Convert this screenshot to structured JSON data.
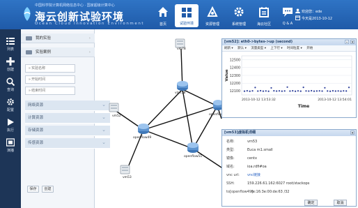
{
  "header": {
    "slogan": "中国科学院计算机网络信息中心 · 国家超级计算中心",
    "title": "海云创新试验环境",
    "subtitle": "Ocean Cloud Innovation Environment",
    "nav": [
      {
        "label": "首页",
        "icon": "home-icon"
      },
      {
        "label": "试验环境",
        "icon": "grid-icon",
        "active": true
      },
      {
        "label": "资源管理",
        "icon": "resource-icon"
      },
      {
        "label": "系统管理",
        "icon": "gear-icon"
      },
      {
        "label": "海云社区",
        "icon": "community-icon"
      },
      {
        "label": "Q & A",
        "icon": "chat-icon"
      }
    ],
    "user": {
      "welcome": "欢迎您：ede",
      "date": "今天是2013-10-12"
    }
  },
  "toolbar": [
    {
      "label": "列表",
      "icon": "list-icon"
    },
    {
      "label": "创建",
      "icon": "plus-icon"
    },
    {
      "label": "查询",
      "icon": "search-icon"
    },
    {
      "label": "配置",
      "icon": "gear-icon"
    },
    {
      "label": "执行",
      "icon": "play-icon"
    },
    {
      "label": "演播",
      "icon": "film-icon"
    }
  ],
  "side": {
    "sections": [
      "我的实验",
      "实验案例"
    ],
    "fields": [
      {
        "placeholder": "» 实验名称"
      },
      {
        "placeholder": "» 开始时间"
      },
      {
        "placeholder": "» 结束时间"
      }
    ],
    "accordions": [
      "网络资源",
      "计算资源",
      "存储资源",
      "传感资源"
    ],
    "buttons": [
      "保存",
      "创建"
    ]
  },
  "topology": {
    "nodes": [
      "vm78",
      "vlan58",
      "vm52",
      "openflow49",
      "openflow51",
      "vm53",
      "openflow"
    ]
  },
  "chart_panel": {
    "title": "[vm52]: eth0->bytes->up (second)",
    "tools": [
      "刷新 ▾",
      "默认 ▾",
      "流量类型 ▾",
      "上下行 ▾",
      "时间粒度 ▾",
      "开始"
    ]
  },
  "chart_data": {
    "type": "scatter",
    "title": "",
    "xlabel": "Time",
    "ylabel": "Value",
    "x_ticks": [
      "2013-10-12 13:53:32",
      "2013-10-12 13:54:01"
    ],
    "ylim": [
      12050,
      12550
    ],
    "y_ticks": [
      12100,
      12200,
      12300,
      12400,
      12500
    ],
    "series": [
      {
        "values": [
          12098,
          12103,
          12097,
          12102,
          12145,
          12099,
          12104,
          12098,
          12101,
          12097,
          12140,
          12103,
          12099,
          12102,
          12098,
          12101,
          12150,
          12099,
          12103,
          12097,
          12102,
          12098,
          12147,
          12101,
          12099,
          12104,
          12098,
          12100,
          12102,
          12099,
          12141,
          12100,
          12097,
          12103,
          12099,
          12101,
          12098,
          12102,
          12100,
          12146
        ]
      }
    ]
  },
  "info_panel": {
    "title": "[vm53]虚拟机详细",
    "rows": [
      {
        "k": "名称:",
        "v": "vm53"
      },
      {
        "k": "类型:",
        "v": "Euca m1.small"
      },
      {
        "k": "镜像:",
        "v": "centx"
      },
      {
        "k": "域名:",
        "v": "ioa.rdfi#oa"
      },
      {
        "k": "vnc url:",
        "v": "vnc链接",
        "link": true
      },
      {
        "k": "SSH:",
        "v": "159.226.61.162:6027 root/stackops"
      },
      {
        "k": "to[openflow49]:",
        "v": "fe:16:3e:00:de:63 /32"
      }
    ],
    "buttons": [
      "确定",
      "取消"
    ]
  }
}
